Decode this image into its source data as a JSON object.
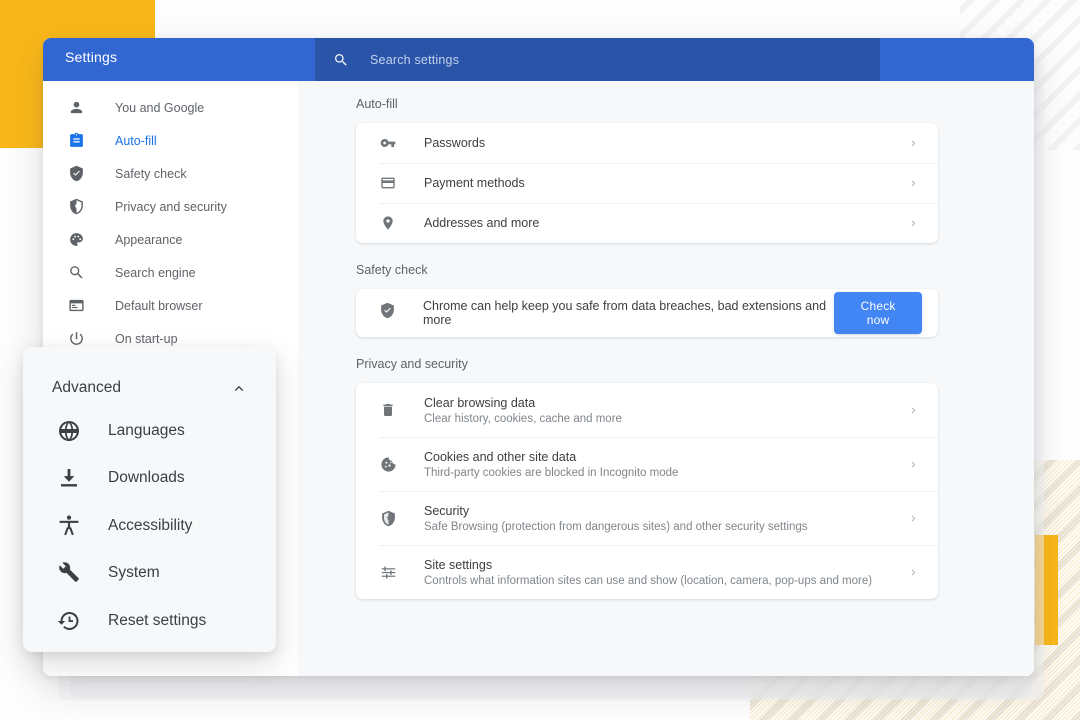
{
  "window": {
    "header": {
      "title": "Settings",
      "search_icon": "search-icon",
      "search_placeholder": "Search settings",
      "search_value": ""
    },
    "colors": {
      "header_blue": "#3266d0",
      "search_blue": "#2a54a8",
      "accent_blue": "#1a73e8",
      "button_blue": "#4285f4",
      "deco_yellow": "#f9b719",
      "content_bg": "#f6f8fa",
      "text_primary": "#3c4043",
      "text_secondary": "#5f6368",
      "text_muted": "#80868b"
    }
  },
  "sidebar": {
    "items": [
      {
        "label": "You and Google",
        "icon": "person-icon",
        "active": false
      },
      {
        "label": "Auto-fill",
        "icon": "clipboard-icon",
        "active": true
      },
      {
        "label": "Safety check",
        "icon": "shield-check-icon",
        "active": false
      },
      {
        "label": "Privacy and security",
        "icon": "shield-lock-icon",
        "active": false
      },
      {
        "label": "Appearance",
        "icon": "palette-icon",
        "active": false
      },
      {
        "label": "Search engine",
        "icon": "search-icon",
        "active": false
      },
      {
        "label": "Default browser",
        "icon": "browser-window-icon",
        "active": false
      },
      {
        "label": "On start-up",
        "icon": "power-icon",
        "active": false
      }
    ]
  },
  "content": {
    "sections": [
      {
        "title": "Auto-fill",
        "rows": [
          {
            "title": "Passwords",
            "subtitle": "",
            "icon": "key-icon",
            "chevron": "chevron-right-icon"
          },
          {
            "title": "Payment methods",
            "subtitle": "",
            "icon": "credit-card-icon",
            "chevron": "chevron-right-icon"
          },
          {
            "title": "Addresses and more",
            "subtitle": "",
            "icon": "location-pin-icon",
            "chevron": "chevron-right-icon"
          }
        ]
      },
      {
        "title": "Safety check",
        "safety": {
          "icon": "shield-check-icon",
          "message": "Chrome can help keep you safe from data breaches, bad extensions and more",
          "button_label": "Check now"
        }
      },
      {
        "title": "Privacy and security",
        "rows": [
          {
            "title": "Clear browsing data",
            "subtitle": "Clear history, cookies, cache and more",
            "icon": "trash-icon",
            "chevron": "chevron-right-icon"
          },
          {
            "title": "Cookies and other site data",
            "subtitle": "Third-party cookies are blocked in Incognito mode",
            "icon": "cookie-icon",
            "chevron": "chevron-right-icon"
          },
          {
            "title": "Security",
            "subtitle": "Safe Browsing (protection from dangerous sites) and other security settings",
            "icon": "shield-lock-icon",
            "chevron": "chevron-right-icon"
          },
          {
            "title": "Site settings",
            "subtitle": "Controls what information sites can use and show (location, camera, pop-ups and more)",
            "icon": "tune-sliders-icon",
            "chevron": "chevron-right-icon"
          }
        ]
      }
    ]
  },
  "advanced_panel": {
    "title": "Advanced",
    "collapse_icon": "chevron-up-icon",
    "items": [
      {
        "label": "Languages",
        "icon": "globe-icon"
      },
      {
        "label": "Downloads",
        "icon": "download-icon"
      },
      {
        "label": "Accessibility",
        "icon": "accessibility-icon"
      },
      {
        "label": "System",
        "icon": "wrench-icon"
      },
      {
        "label": "Reset settings",
        "icon": "history-restore-icon"
      }
    ]
  }
}
